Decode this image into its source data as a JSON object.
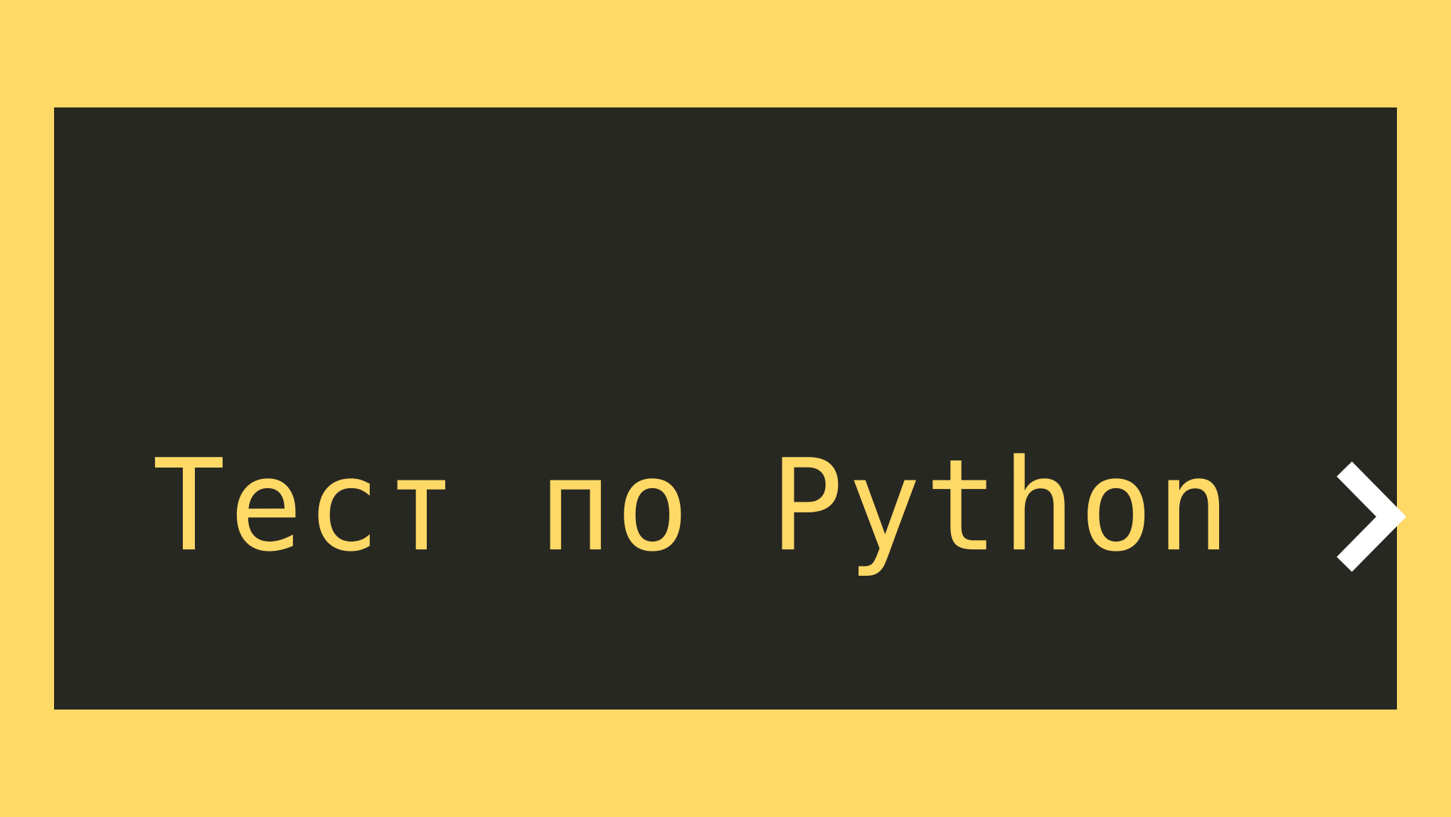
{
  "banner": {
    "title": "Тест по Python",
    "arrow_icon": "chevron-right-icon",
    "colors": {
      "background": "#FFD966",
      "panel": "#282822",
      "text": "#FFD966",
      "arrow": "#FFFFFF"
    }
  }
}
